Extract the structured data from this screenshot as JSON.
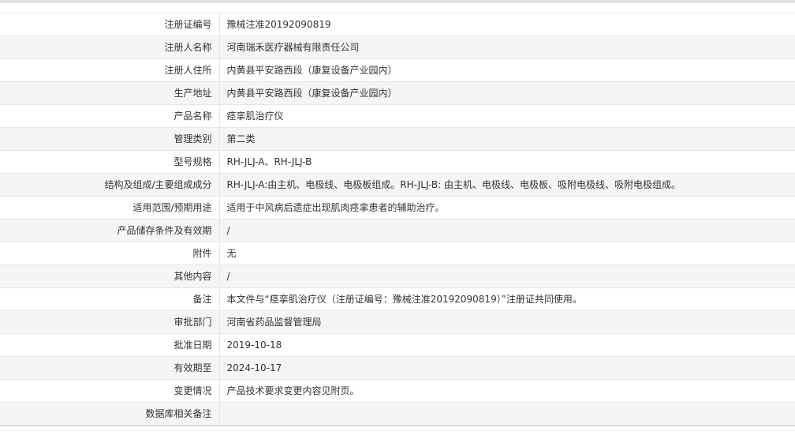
{
  "rows": [
    {
      "label": "注册证编号",
      "value": "豫械注准20192090819"
    },
    {
      "label": "注册人名称",
      "value": "河南瑞禾医疗器械有限责任公司"
    },
    {
      "label": "注册人住所",
      "value": "内黄县平安路西段（康复设备产业园内）"
    },
    {
      "label": "生产地址",
      "value": "内黄县平安路西段（康复设备产业园内）"
    },
    {
      "label": "产品名称",
      "value": "痉挛肌治疗仪"
    },
    {
      "label": "管理类别",
      "value": "第二类"
    },
    {
      "label": "型号规格",
      "value": "RH-JLJ-A、RH-JLJ-B"
    },
    {
      "label": "结构及组成/主要组成成分",
      "value": "RH-JLJ-A:由主机、电极线、电极板组成。RH-JLJ-B: 由主机、电极线、电极板、吸附电极线、吸附电极组成。"
    },
    {
      "label": "适用范围/预期用途",
      "value": "适用于中风病后遗症出现肌肉痉挛患者的辅助治疗。"
    },
    {
      "label": "产品储存条件及有效期",
      "value": "/"
    },
    {
      "label": "附件",
      "value": "无"
    },
    {
      "label": "其他内容",
      "value": "/"
    },
    {
      "label": "备注",
      "value": "本文件与“痉挛肌治疗仪（注册证编号：豫械注准20192090819）”注册证共同使用。"
    },
    {
      "label": "审批部门",
      "value": "河南省药品监督管理局"
    },
    {
      "label": "批准日期",
      "value": "2019-10-18"
    },
    {
      "label": "有效期至",
      "value": "2024-10-17"
    },
    {
      "label": "变更情况",
      "value": "产品技术要求变更内容见附页。"
    },
    {
      "label": "数据库相关备注",
      "value": ""
    }
  ]
}
